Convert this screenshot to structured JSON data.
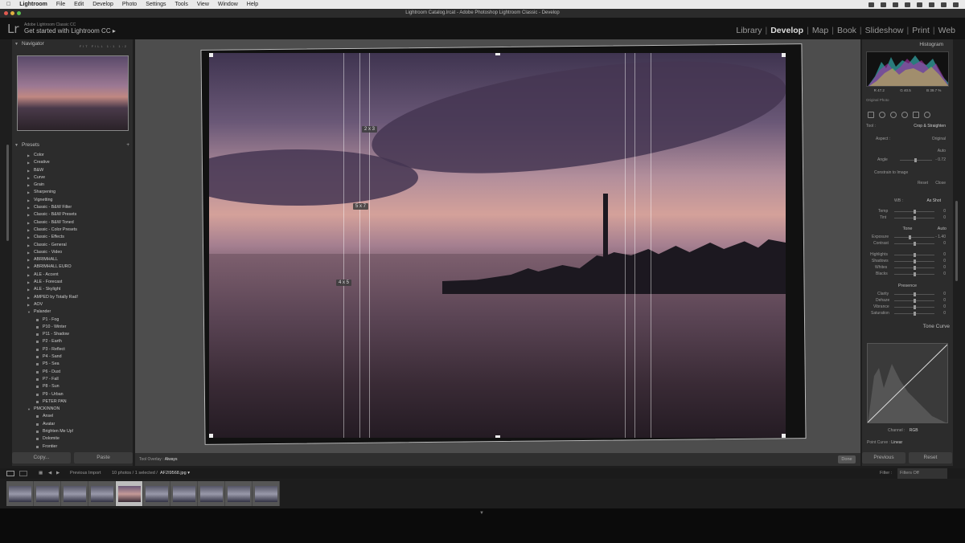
{
  "menubar": {
    "items": [
      "Lightroom",
      "File",
      "Edit",
      "Develop",
      "Photo",
      "Settings",
      "Tools",
      "View",
      "Window",
      "Help"
    ]
  },
  "window_title": "Lightroom Catalog.lrcat - Adobe Photoshop Lightroom Classic - Develop",
  "identity": {
    "logo": "Lr",
    "account_small": "Adobe Lightroom Classic CC",
    "account_big": "Get started with Lightroom CC ▸"
  },
  "modules": [
    "Library",
    "Develop",
    "Map",
    "Book",
    "Slideshow",
    "Print",
    "Web"
  ],
  "active_module": "Develop",
  "navigator": {
    "title": "Navigator",
    "zoom": "FIT FILL 1:1 1:2"
  },
  "presets": {
    "title": "Presets",
    "add": "+",
    "items": [
      {
        "label": "Color",
        "level": 0
      },
      {
        "label": "Creative",
        "level": 0
      },
      {
        "label": "B&W",
        "level": 0
      },
      {
        "label": "Curve",
        "level": 0
      },
      {
        "label": "Grain",
        "level": 0
      },
      {
        "label": "Sharpening",
        "level": 0
      },
      {
        "label": "Vignetting",
        "level": 0
      },
      {
        "label": "Classic - B&W Filter",
        "level": 0
      },
      {
        "label": "Classic - B&W Presets",
        "level": 0
      },
      {
        "label": "Classic - B&W Toned",
        "level": 0
      },
      {
        "label": "Classic - Color Presets",
        "level": 0
      },
      {
        "label": "Classic - Effects",
        "level": 0
      },
      {
        "label": "Classic - General",
        "level": 0
      },
      {
        "label": "Classic - Video",
        "level": 0
      },
      {
        "label": "ABRIMHALL",
        "level": 0
      },
      {
        "label": "ABRIMHALL EURO",
        "level": 0
      },
      {
        "label": "ALE - Accent",
        "level": 0
      },
      {
        "label": "ALE - Forecast",
        "level": 0
      },
      {
        "label": "ALE - Skylight",
        "level": 0
      },
      {
        "label": "AMPED by Totally Rad!",
        "level": 0
      },
      {
        "label": "AOV",
        "level": 0
      },
      {
        "label": "Palander",
        "level": 0,
        "open": true
      },
      {
        "label": "P1 - Fog",
        "level": 1
      },
      {
        "label": "P10 - Winter",
        "level": 1
      },
      {
        "label": "P11 - Shadow",
        "level": 1
      },
      {
        "label": "P2 - Earth",
        "level": 1
      },
      {
        "label": "P3 - Reflect",
        "level": 1
      },
      {
        "label": "P4 - Sand",
        "level": 1
      },
      {
        "label": "P5 - Sea",
        "level": 1
      },
      {
        "label": "P6 - Dust",
        "level": 1
      },
      {
        "label": "P7 - Fall",
        "level": 1
      },
      {
        "label": "P8 - Sun",
        "level": 1
      },
      {
        "label": "P9 - Urban",
        "level": 1
      },
      {
        "label": "PETER PAN",
        "level": 1
      },
      {
        "label": "PMCKINNON",
        "level": 0,
        "open": true
      },
      {
        "label": "Ansel",
        "level": 1
      },
      {
        "label": "Avatar",
        "level": 1
      },
      {
        "label": "Brighten Me Up!",
        "level": 1
      },
      {
        "label": "Dolomite",
        "level": 1
      },
      {
        "label": "Frontier",
        "level": 1
      }
    ]
  },
  "left_buttons": {
    "copy": "Copy...",
    "paste": "Paste"
  },
  "crop_overlay": {
    "labels": [
      "2 x 3",
      "5 x 7",
      "4 x 5"
    ]
  },
  "toolbar": {
    "label": "Tool Overlay :",
    "value": "Always",
    "done": "Done"
  },
  "right": {
    "histogram_title": "Histogram",
    "hist_stats": [
      "R 47.2",
      "G 40.5",
      "B 39.7 %"
    ],
    "original_photo": "Original Photo",
    "tool_label": "Tool :",
    "tool_value": "Crop & Straighten",
    "aspect_label": "Aspect :",
    "aspect_value": "Original",
    "auto": "Auto",
    "angle_label": "Angle",
    "angle_value": "- 0.72",
    "constrain": "Constrain to Image",
    "reset": "Reset",
    "close": "Close",
    "wb_label": "WB :",
    "wb_value": "As Shot",
    "temp": "Temp",
    "tint": "Tint",
    "tone_title": "Tone",
    "tone_auto": "Auto",
    "exposure": "Exposure",
    "exposure_value": "- 1.40",
    "contrast": "Contrast",
    "highlights": "Highlights",
    "shadows": "Shadows",
    "whites": "Whites",
    "blacks": "Blacks",
    "presence_title": "Presence",
    "clarity": "Clarity",
    "dehaze": "Dehaze",
    "vibrance": "Vibrance",
    "saturation": "Saturation",
    "tone_curve_title": "Tone Curve",
    "channel_label": "Channel :",
    "channel_value": "RGB",
    "point_curve_label": "Point Curve :",
    "point_curve_value": "Linear",
    "zero": "0"
  },
  "right_buttons": {
    "previous": "Previous",
    "reset": "Reset"
  },
  "filmbar": {
    "source": "Previous Import",
    "count": "10 photos / 1 selected /",
    "file": "AF2I9568.jpg ▾",
    "filter_label": "Filter :",
    "filter_value": "Filters Off"
  },
  "filmstrip": {
    "count": 10,
    "selected": 4
  }
}
